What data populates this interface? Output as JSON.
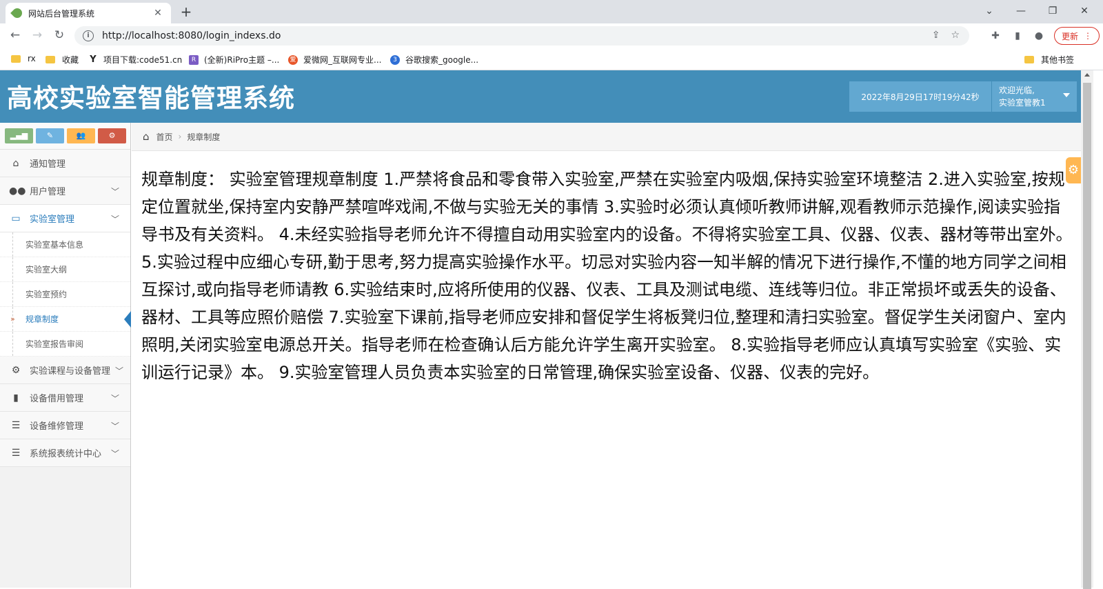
{
  "browser": {
    "tab_title": "网站后台管理系统",
    "url": "http://localhost:8080/login_indexs.do",
    "update_label": "更新",
    "bookmarks": [
      {
        "label": "rx"
      },
      {
        "label": "收藏"
      },
      {
        "label": "项目下载:code51.cn"
      },
      {
        "label": "(全新)RiPro主题 –..."
      },
      {
        "label": "爱微网_互联网专业..."
      },
      {
        "label": "谷歌搜索_google..."
      },
      {
        "label": "其他书签"
      }
    ]
  },
  "header": {
    "title": "高校实验室智能管理系统",
    "datetime": "2022年8月29日17时19分42秒",
    "welcome": "欢迎光临,",
    "username": "实验室管教1"
  },
  "sidebar": {
    "items": [
      {
        "label": "通知管理",
        "icon": "home-icon"
      },
      {
        "label": "用户管理",
        "icon": "users-icon"
      },
      {
        "label": "实验室管理",
        "icon": "desktop-icon"
      },
      {
        "label": "实验课程与设备管理",
        "icon": "cogs-icon"
      },
      {
        "label": "设备借用管理",
        "icon": "bookmark-icon"
      },
      {
        "label": "设备维修管理",
        "icon": "list-icon"
      },
      {
        "label": "系统报表统计中心",
        "icon": "list-icon"
      }
    ],
    "sub_items": [
      {
        "label": "实验室基本信息"
      },
      {
        "label": "实验室大纲"
      },
      {
        "label": "实验室预约"
      },
      {
        "label": "规章制度"
      },
      {
        "label": "实验室报告审阅"
      }
    ]
  },
  "breadcrumb": {
    "home": "首页",
    "current": "规章制度"
  },
  "content": {
    "text": "规章制度： 实验室管理规章制度 1.严禁将食品和零食带入实验室,严禁在实验室内吸烟,保持实验室环境整洁 2.进入实验室,按规定位置就坐,保持室内安静严禁喧哗戏闹,不做与实验无关的事情 3.实验时必须认真倾听教师讲解,观看教师示范操作,阅读实验指导书及有关资料。 4.未经实验指导老师允许不得擅自动用实验室内的设备。不得将实验室工具、仪器、仪表、器材等带出室外。 5.实验过程中应细心专研,勤于思考,努力提高实验操作水平。切忌对实验内容一知半解的情况下进行操作,不懂的地方同学之间相互探讨,或向指导老师请教 6.实验结束时,应将所使用的仪器、仪表、工具及测试电缆、连线等归位。非正常损坏或丢失的设备、器材、工具等应照价赔偿 7.实验室下课前,指导老师应安排和督促学生将板凳归位,整理和清扫实验室。督促学生关闭窗户、室内照明,关闭实验室电源总开关。指导老师在检查确认后方能允许学生离开实验室。 8.实验指导老师应认真填写实验室《实验、实训运行记录》本。 9.实验室管理人员负责本实验室的日常管理,确保实验室设备、仪器、仪表的完好。"
  },
  "colors": {
    "header_bg": "#438eb9",
    "header_box": "#62a8d1",
    "shortcut_green": "#87b87f",
    "shortcut_blue": "#6fb3e0",
    "shortcut_orange": "#ffb752",
    "shortcut_red": "#d15b47",
    "active_blue": "#2b7dbc"
  }
}
